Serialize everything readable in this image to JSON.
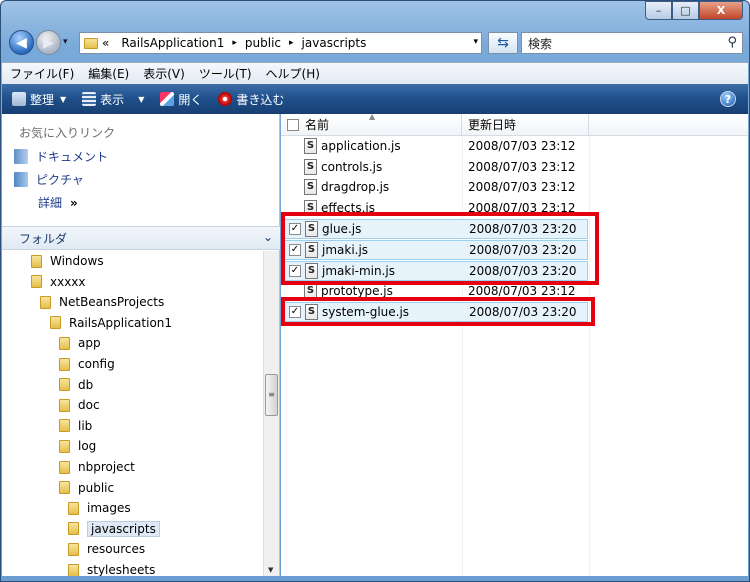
{
  "window": {
    "caption": {
      "minimize": "–",
      "maximize": "□",
      "close": "X"
    }
  },
  "nav": {
    "history_drop": "▾",
    "breadcrumb": [
      {
        "label": "«"
      },
      {
        "label": "RailsApplication1"
      },
      {
        "label": "public"
      },
      {
        "label": "javascripts"
      }
    ],
    "crumb_sep": "▸",
    "search_placeholder": "検索"
  },
  "menubar": {
    "items": [
      "ファイル(F)",
      "編集(E)",
      "表示(V)",
      "ツール(T)",
      "ヘルプ(H)"
    ]
  },
  "toolbar": {
    "organize": "整理",
    "views": "表示",
    "open": "開く",
    "burn": "書き込む",
    "help": "?"
  },
  "left_pane": {
    "favorites_title": "お気に入りリンク",
    "favorites": [
      "ドキュメント",
      "ピクチャ"
    ],
    "more_label": "詳細",
    "more_chev": "»",
    "folders_title": "フォルダ",
    "tree": [
      {
        "label": "Windows",
        "level": 0
      },
      {
        "label": "xxxxx",
        "level": 0
      },
      {
        "label": "NetBeansProjects",
        "level": 1
      },
      {
        "label": "RailsApplication1",
        "level": 2
      },
      {
        "label": "app",
        "level": 3
      },
      {
        "label": "config",
        "level": 3
      },
      {
        "label": "db",
        "level": 3
      },
      {
        "label": "doc",
        "level": 3
      },
      {
        "label": "lib",
        "level": 3
      },
      {
        "label": "log",
        "level": 3
      },
      {
        "label": "nbproject",
        "level": 3
      },
      {
        "label": "public",
        "level": 3
      },
      {
        "label": "images",
        "level": 4
      },
      {
        "label": "javascripts",
        "level": 4,
        "selected": true
      },
      {
        "label": "resources",
        "level": 4
      },
      {
        "label": "stylesheets",
        "level": 4
      }
    ]
  },
  "file_list": {
    "columns": {
      "name": "名前",
      "modified": "更新日時"
    },
    "files": [
      {
        "name": "application.js",
        "date": "2008/07/03 23:12",
        "selected": false
      },
      {
        "name": "controls.js",
        "date": "2008/07/03 23:12",
        "selected": false
      },
      {
        "name": "dragdrop.js",
        "date": "2008/07/03 23:12",
        "selected": false
      },
      {
        "name": "effects.js",
        "date": "2008/07/03 23:12",
        "selected": false
      },
      {
        "name": "glue.js",
        "date": "2008/07/03 23:20",
        "selected": true
      },
      {
        "name": "jmaki.js",
        "date": "2008/07/03 23:20",
        "selected": true
      },
      {
        "name": "jmaki-min.js",
        "date": "2008/07/03 23:20",
        "selected": true
      },
      {
        "name": "prototype.js",
        "date": "2008/07/03 23:12",
        "selected": false
      },
      {
        "name": "system-glue.js",
        "date": "2008/07/03 23:20",
        "selected": true
      }
    ]
  },
  "colors": {
    "highlight": "#e4000f",
    "selection_bg": "#e6f3fb",
    "toolbar": "#1f4f8a"
  }
}
